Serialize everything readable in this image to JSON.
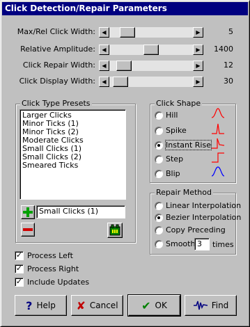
{
  "window": {
    "title": "Click Detection/Repair Parameters"
  },
  "sliders": [
    {
      "label": "Max/Rel Click Width:",
      "value": "5",
      "position": 0.15
    },
    {
      "label": "Relative Amplitude:",
      "value": "1400",
      "position": 0.5
    },
    {
      "label": "Click Repair Width:",
      "value": "12",
      "position": 0.1
    },
    {
      "label": "Click Display Width:",
      "value": "30",
      "position": 0.05
    }
  ],
  "presets": {
    "title": "Click Type Presets",
    "items": [
      "Larger Clicks",
      "Minor Ticks (1)",
      "Minor Ticks (2)",
      "Moderate Clicks",
      "Small Clicks (1)",
      "Small Clicks (2)",
      "Smeared Ticks"
    ],
    "name_value": "Small Clicks (1)",
    "add_icon": "plus-icon",
    "remove_icon": "minus-icon",
    "save_icon": "save-preset-icon"
  },
  "shape": {
    "title": "Click Shape",
    "options": [
      "Hill",
      "Spike",
      "Instant Rise",
      "Step",
      "Blip"
    ],
    "selected": "Instant Rise",
    "wave_color": "#ff0000",
    "blip_color": "#0000ff"
  },
  "repair": {
    "title": "Repair Method",
    "options": [
      "Linear Interpolation",
      "Bezier Interpolation",
      "Copy Preceding",
      "Smooth"
    ],
    "selected": "Bezier Interpolation",
    "smooth_value": "3",
    "smooth_suffix": "times"
  },
  "checks": [
    {
      "label": "Process Left",
      "checked": true
    },
    {
      "label": "Process Right",
      "checked": true
    },
    {
      "label": "Include Updates",
      "checked": true
    }
  ],
  "buttons": {
    "help": "Help",
    "help_icon": "question-icon",
    "help_color": "#000080",
    "cancel": "Cancel",
    "cancel_icon": "x-icon",
    "cancel_color": "#c00000",
    "ok": "OK",
    "ok_icon": "checkmark-icon",
    "ok_color": "#008000",
    "find": "Find",
    "find_icon": "waveform-icon",
    "find_color": "#000080"
  }
}
